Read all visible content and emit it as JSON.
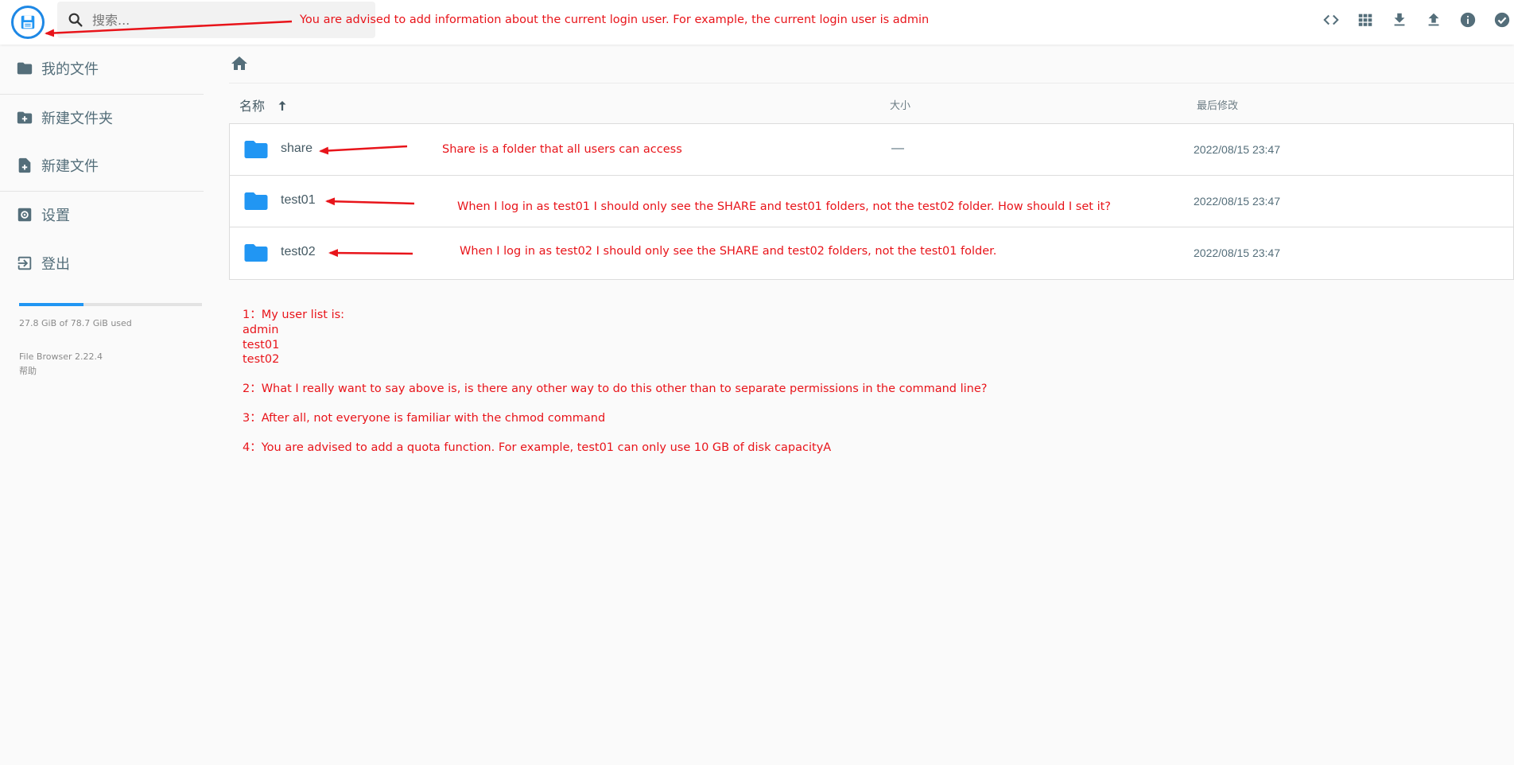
{
  "header": {
    "search_placeholder": "搜索...",
    "icons": [
      "logo-icon",
      "search-icon",
      "code-icon",
      "grid-view-icon",
      "download-icon",
      "upload-icon",
      "info-icon",
      "select-check-icon"
    ]
  },
  "sidebar": {
    "items": [
      {
        "label": "我的文件",
        "icon": "folder-icon"
      },
      {
        "label": "新建文件夹",
        "icon": "new-folder-icon"
      },
      {
        "label": "新建文件",
        "icon": "new-file-icon"
      },
      {
        "label": "设置",
        "icon": "settings-icon"
      },
      {
        "label": "登出",
        "icon": "logout-icon"
      }
    ],
    "quota_text": "27.8 GiB of 78.7 GiB used",
    "quota_fraction": 0.353,
    "version": "File Browser 2.22.4",
    "help": "帮助"
  },
  "listing": {
    "breadcrumb_icon": "home-icon",
    "columns": {
      "name": "名称",
      "size": "大小",
      "modified": "最后修改"
    },
    "sort_icon": "arrow-up-icon",
    "rows": [
      {
        "name": "share",
        "size": "—",
        "modified": "2022/08/15 23:47"
      },
      {
        "name": "test01",
        "size": "",
        "modified": "2022/08/15 23:47"
      },
      {
        "name": "test02",
        "size": "",
        "modified": "2022/08/15 23:47"
      }
    ]
  },
  "annotations": {
    "login_note": "You are advised to add information about the current login user. For example, the current login user is admin",
    "share_note": "Share is a folder that all users can access",
    "test01_note": "When I log in as test01 I should only see the SHARE and test01 folders, not the test02 folder. How should I set it?",
    "test02_note": "When I log in as test02 I should only see the SHARE and test02 folders, not the test01 folder.",
    "notes": {
      "n1": "1：My user list is:",
      "n1_users": [
        "admin",
        "test01",
        "test02"
      ],
      "n2": "2：What I really want to say above is, is there any other way to do this other than to separate permissions in the command line?",
      "n3": "3：After all, not everyone is familiar with the chmod command",
      "n4": "4：You are advised to add a quota function. For example, test01 can only use 10 GB of disk capacityA"
    },
    "color": "#e8141a"
  },
  "colors": {
    "accent": "#2196f3",
    "icon": "#546e7a",
    "folder": "#2196f3"
  }
}
